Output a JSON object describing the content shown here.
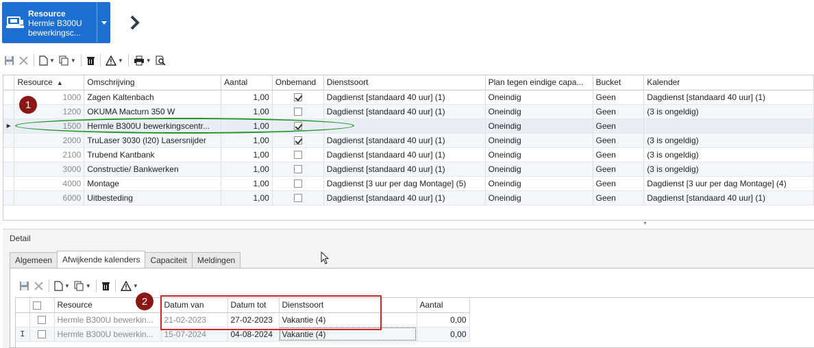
{
  "header": {
    "resource_button": {
      "title": "Resource",
      "line2": "Hermle B300U",
      "line3": "bewerkingsc..."
    }
  },
  "top_grid": {
    "columns": [
      "Resource",
      "Omschrijving",
      "Aantal",
      "Onbemand",
      "Dienstsoort",
      "Plan tegen eindige capa...",
      "Bucket",
      "Kalender"
    ],
    "rows": [
      {
        "resource": "1000",
        "omschrijving": "Zagen Kaltenbach",
        "aantal": "1,00",
        "onbemand": true,
        "dienstsoort": "Dagdienst [standaard 40 uur] (1)",
        "plan": "Oneindig",
        "bucket": "Geen",
        "kalender": "Dagdienst [standaard 40 uur] (1)"
      },
      {
        "resource": "1200",
        "omschrijving": "OKUMA Macturn 350 W",
        "aantal": "1,00",
        "onbemand": false,
        "dienstsoort": "Dagdienst [standaard 40 uur] (1)",
        "plan": "Oneindig",
        "bucket": "Geen",
        "kalender": "(3 is ongeldig)"
      },
      {
        "resource": "1500",
        "omschrijving": "Hermle B300U bewerkingscentr...",
        "aantal": "1,00",
        "onbemand": true,
        "dienstsoort": "",
        "plan": "Oneindig",
        "bucket": "Geen",
        "kalender": ""
      },
      {
        "resource": "2000",
        "omschrijving": "TruLaser 3030 (l20) Lasersnijder",
        "aantal": "1,00",
        "onbemand": true,
        "dienstsoort": "Dagdienst [standaard 40 uur] (1)",
        "plan": "Oneindig",
        "bucket": "Geen",
        "kalender": "(3 is ongeldig)"
      },
      {
        "resource": "2100",
        "omschrijving": "Trubend Kantbank",
        "aantal": "1,00",
        "onbemand": false,
        "dienstsoort": "Dagdienst [standaard 40 uur] (1)",
        "plan": "Oneindig",
        "bucket": "Geen",
        "kalender": "(3 is ongeldig)"
      },
      {
        "resource": "3000",
        "omschrijving": "Constructie/ Bankwerken",
        "aantal": "1,00",
        "onbemand": false,
        "dienstsoort": "Dagdienst [standaard 40 uur] (1)",
        "plan": "Oneindig",
        "bucket": "Geen",
        "kalender": "(3 is ongeldig)"
      },
      {
        "resource": "4000",
        "omschrijving": "Montage",
        "aantal": "1,00",
        "onbemand": false,
        "dienstsoort": "Dagdienst [3 uur per dag Montage] (5)",
        "plan": "Oneindig",
        "bucket": "Geen",
        "kalender": "Dagdienst [3 uur per dag Montage] (4)"
      },
      {
        "resource": "6000",
        "omschrijving": "Uitbesteding",
        "aantal": "1,00",
        "onbemand": false,
        "dienstsoort": "Dagdienst [standaard 40 uur] (1)",
        "plan": "Oneindig",
        "bucket": "Geen",
        "kalender": "Dagdienst [standaard 40 uur] (1)"
      }
    ]
  },
  "callouts": {
    "one": "1",
    "two": "2"
  },
  "detail": {
    "title": "Detail",
    "tabs": [
      "Algemeen",
      "Afwijkende kalenders",
      "Capaciteit",
      "Meldingen"
    ],
    "active_tab": "Afwijkende kalenders"
  },
  "detail_grid": {
    "columns": [
      "Resource",
      "Datum van",
      "Datum tot",
      "Dienstsoort",
      "Aantal"
    ],
    "rows": [
      {
        "resource": "Hermle B300U bewerkin...",
        "datum_van": "21-02-2023",
        "datum_tot": "27-02-2023",
        "dienstsoort": "Vakantie (4)",
        "aantal": "0,00"
      },
      {
        "resource": "Hermle B300U bewerkin...",
        "datum_van": "15-07-2024",
        "datum_tot": "04-08-2024",
        "dienstsoort": "Vakantie (4)",
        "aantal": "0,00"
      }
    ]
  },
  "colors": {
    "accent": "#1d6fd2",
    "callout": "#8b1616",
    "highlight_ellipse": "#1e9624",
    "highlight_box": "#cc2a2a"
  }
}
